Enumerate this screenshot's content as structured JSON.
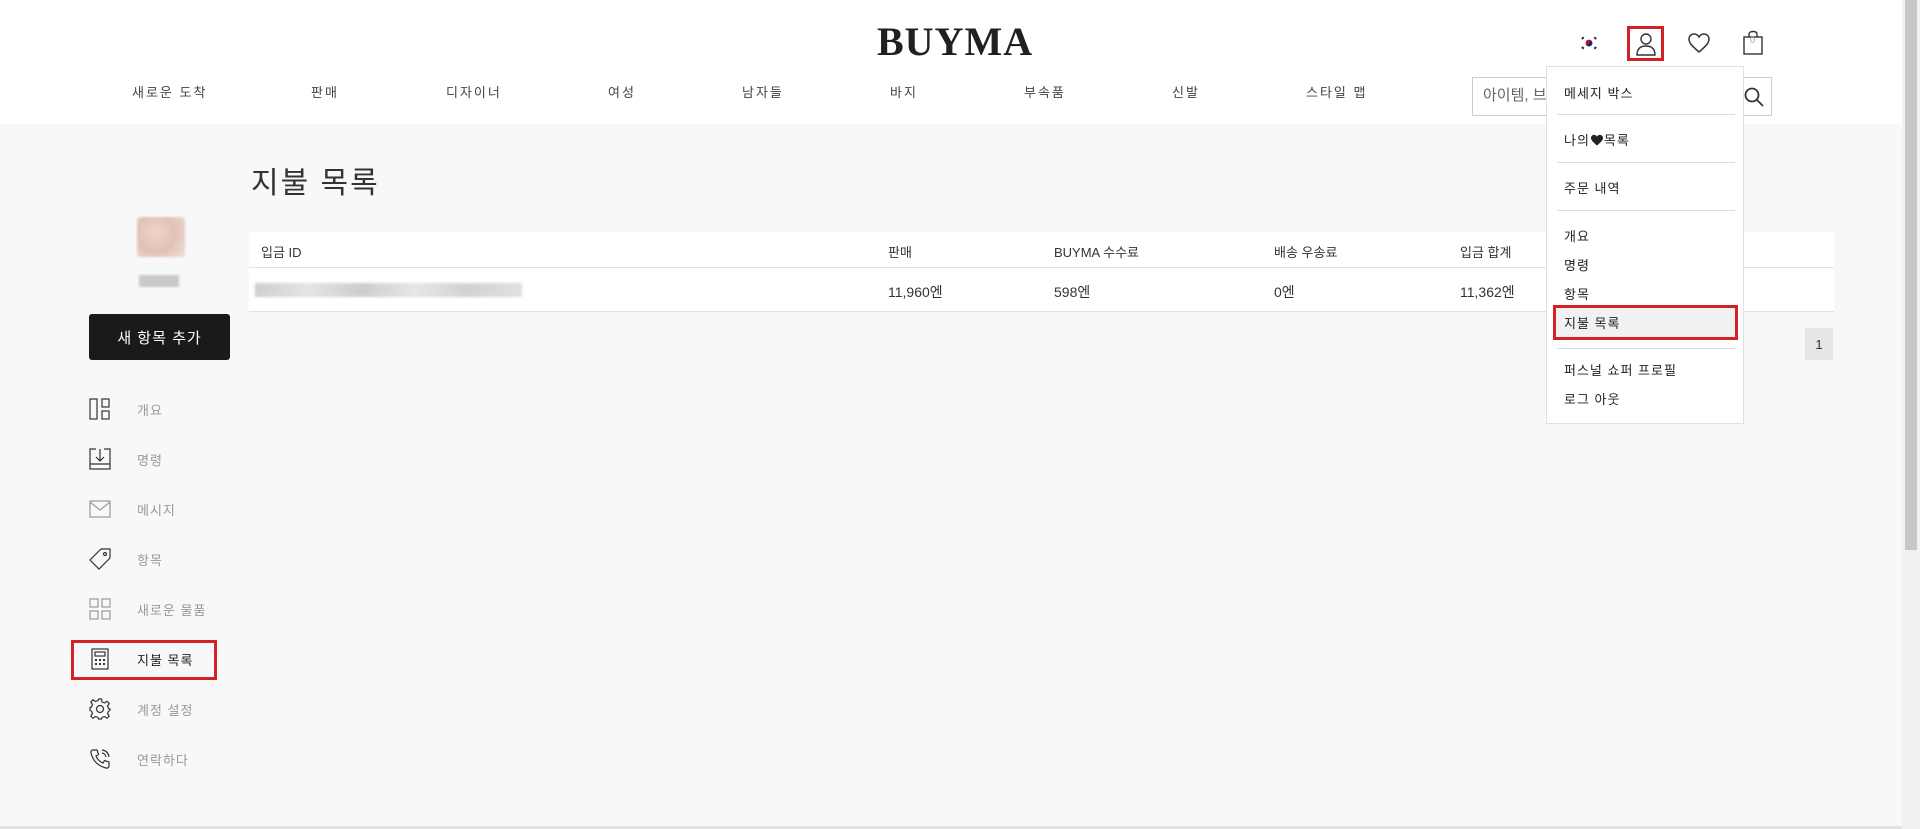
{
  "header": {
    "logo": "BUYMA",
    "cart_count": "0"
  },
  "nav": {
    "items": [
      "새로운 도착",
      "판매",
      "디자이너",
      "여성",
      "남자들",
      "바지",
      "부속품",
      "신발",
      "스타일 맵"
    ]
  },
  "search": {
    "placeholder": "아이템, 브"
  },
  "sidebar": {
    "add_button": "새 항목 추가",
    "items": [
      {
        "label": "개요",
        "icon": "dashboard-icon"
      },
      {
        "label": "명령",
        "icon": "download-tray-icon"
      },
      {
        "label": "메시지",
        "icon": "envelope-icon"
      },
      {
        "label": "항목",
        "icon": "price-tag-icon"
      },
      {
        "label": "새로운 물품",
        "icon": "grid-icon"
      },
      {
        "label": "지불 목록",
        "icon": "calculator-icon"
      },
      {
        "label": "계정 설정",
        "icon": "gear-icon"
      },
      {
        "label": "연락하다",
        "icon": "phone-icon"
      }
    ],
    "active_index": 5
  },
  "main": {
    "title": "지불 목록",
    "table": {
      "headers": [
        "입금 ID",
        "판매",
        "BUYMA 수수료",
        "배송 우송료",
        "입금 합계"
      ],
      "rows": [
        {
          "sales": "11,960엔",
          "fee": "598엔",
          "shipping": "0엔",
          "total": "11,362엔"
        }
      ]
    },
    "pagination": {
      "current": "1"
    }
  },
  "dropdown": {
    "message_box": "메세지 박스",
    "wishlist_prefix": "나의",
    "wishlist_suffix": "목록",
    "orders": "주문 내역",
    "overview": "개요",
    "commands": "명령",
    "items": "항목",
    "payment_list": "지불 목록",
    "personal_shopper": "퍼스널 쇼퍼 프로필",
    "logout": "로그 아웃"
  },
  "colors": {
    "highlight": "#d42027",
    "button_bg": "#1b1a19"
  }
}
